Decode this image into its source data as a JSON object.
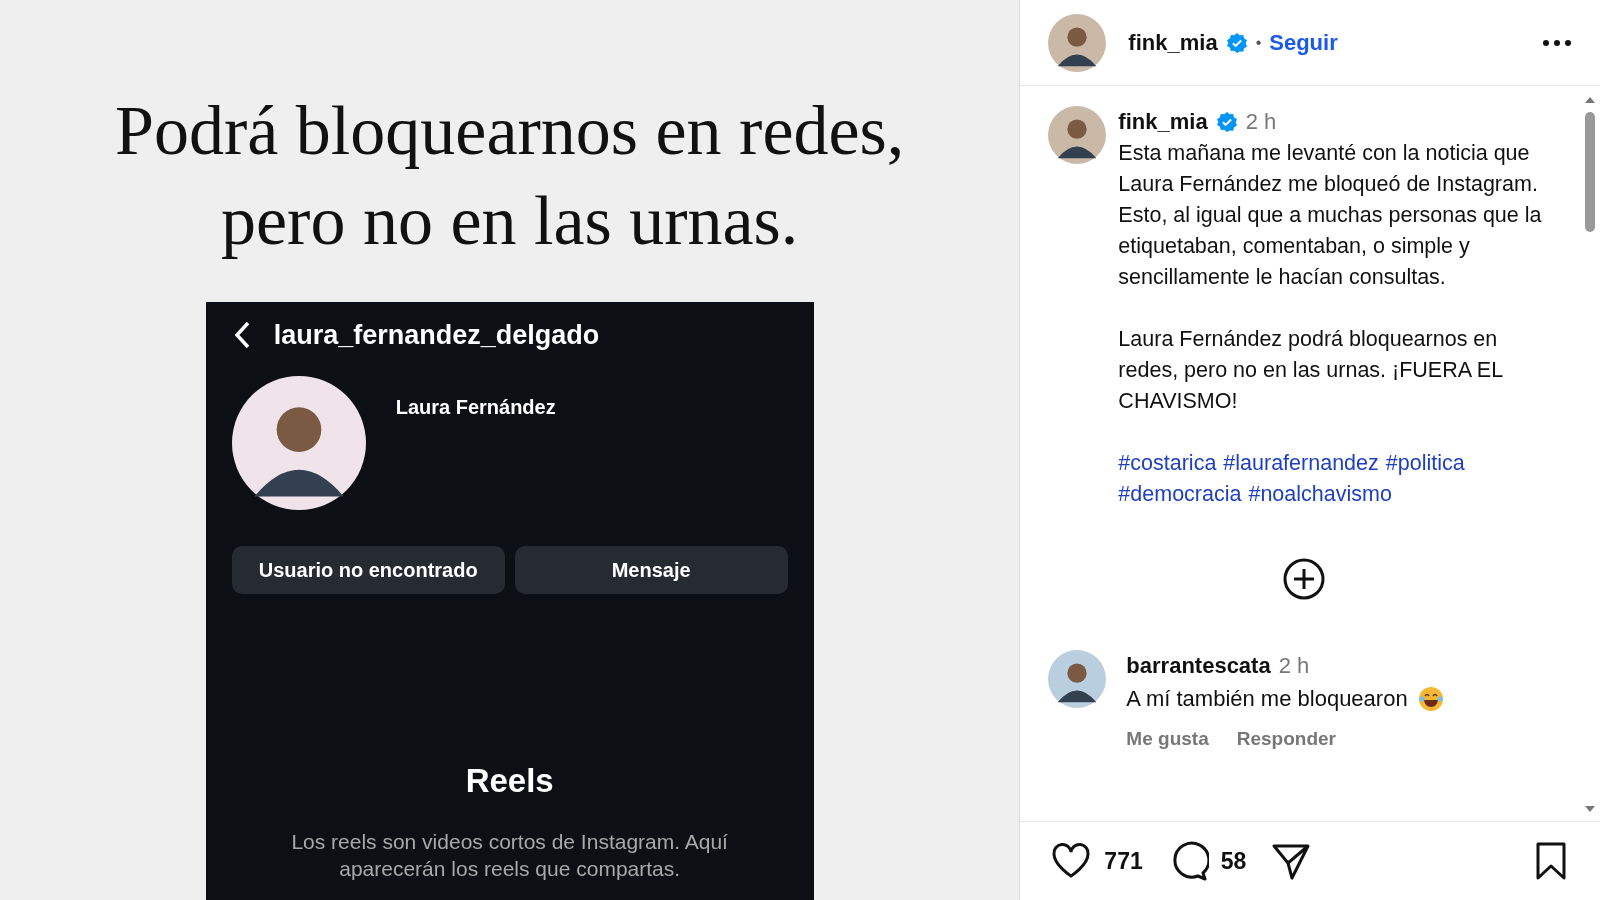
{
  "left": {
    "headline_lines": [
      "Podrá bloquearnos en redes,",
      "pero no en las urnas."
    ],
    "embedded_screen": {
      "username": "laura_fernandez_delgado",
      "name": "Laura Fernández",
      "buttons": [
        "Usuario no encontrado",
        "Mensaje"
      ],
      "section_title": "Reels",
      "section_text": "Los reels son videos cortos de Instagram. Aquí aparecerán los reels que compartas."
    }
  },
  "post": {
    "header": {
      "username": "fink_mia",
      "verified": true,
      "separator": "•",
      "follow": "Seguir"
    },
    "caption": {
      "username": "fink_mia",
      "verified": true,
      "time": "2 h",
      "paragraphs": [
        "Esta mañana me levanté con la noticia que Laura Fernández me bloqueó de Instagram. Esto, al igual que a muchas personas que la etiquetaban, comentaban, o simple y sencillamente le hacían consultas.",
        "Laura Fernández podrá bloquearnos en redes, pero no en las urnas. ¡FUERA EL CHAVISMO!"
      ],
      "hashtags": [
        "#costarica",
        "#laurafernandez",
        "#politica",
        "#democracia",
        "#noalchavismo"
      ]
    },
    "comments": [
      {
        "username": "barrantescata",
        "time": "2 h",
        "text": "A mí también me bloquearon",
        "actions": [
          "Me gusta",
          "Responder"
        ]
      }
    ],
    "likes": "771",
    "comment_count": "58"
  }
}
